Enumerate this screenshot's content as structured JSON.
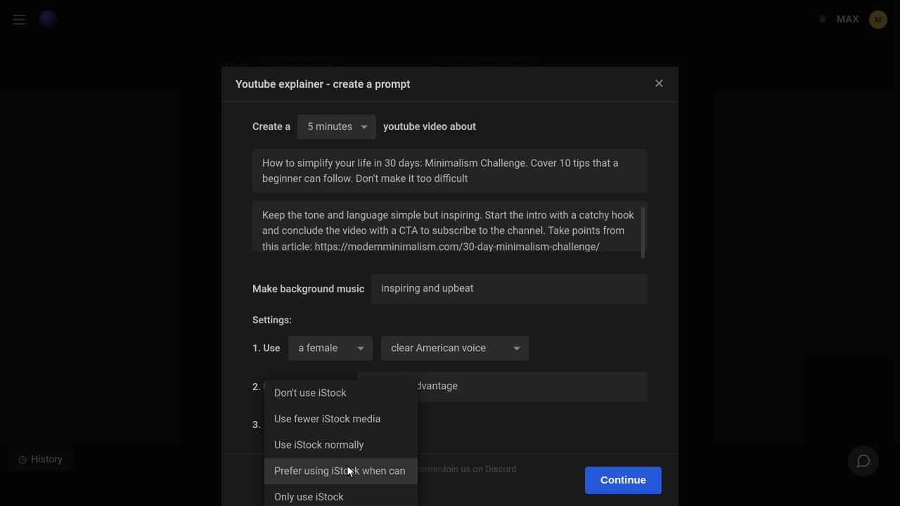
{
  "topbar": {
    "max_label": "MAX",
    "avatar_initials": "M"
  },
  "bg": {
    "model_label": "Model:",
    "model_value": "Premium AI",
    "workflow": "Youtube explainer"
  },
  "modal": {
    "title": "Youtube explainer - create a prompt",
    "create_a": "Create a",
    "duration_value": "5 minutes",
    "video_about": "youtube video about",
    "topic_text": "How to simplify your life in 30 days: Minimalism Challenge. Cover 10 tips that a beginner can follow. Don't make it too difficult",
    "instructions_text": "Keep the tone and language simple but inspiring. Start the intro with a catchy hook and conclude the video with a CTA to subscribe to the channel. Take points from this article: https://modernminimalism.com/30-day-minimalism-challenge/",
    "bgmusic_label": "Make background music",
    "bgmusic_value": "inspiring and upbeat",
    "settings_label": "Settings:",
    "s1_prefix": "1. Use",
    "s1_gender": "a female",
    "s1_voice": "clear American voice",
    "s2_prefix": "2. Use watermark text",
    "s2_value": "The Alex Advantage",
    "s3_prefix": "3.",
    "s3_value": "Use iStock normally",
    "continue_label": "Continue"
  },
  "istock_options": [
    "Don't use iStock",
    "Use fewer iStock media",
    "Use iStock normally",
    "Prefer using iStock when can",
    "Only use iStock"
  ],
  "footer": {
    "history": "History",
    "discord": "Join us on Discord",
    "bg_text": "content."
  }
}
